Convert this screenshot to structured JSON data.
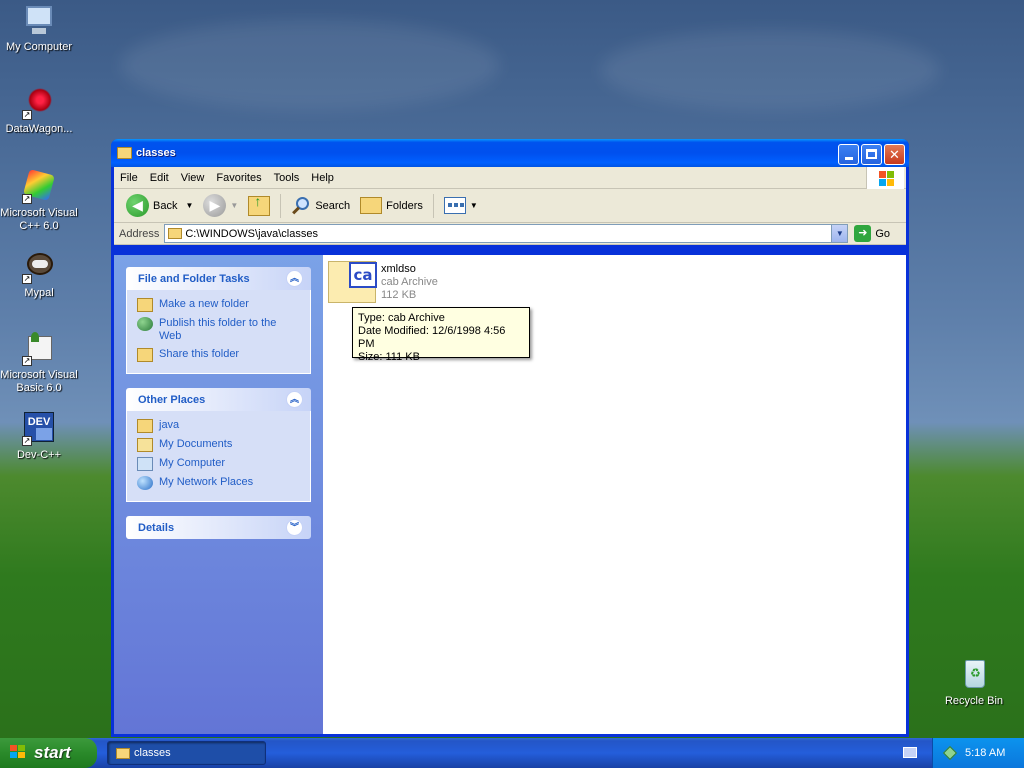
{
  "desktop": {
    "icons": [
      {
        "label": "My Computer"
      },
      {
        "label": "DataWagon..."
      },
      {
        "label": "Microsoft Visual C++ 6.0"
      },
      {
        "label": "Mypal"
      },
      {
        "label": "Microsoft Visual Basic 6.0"
      },
      {
        "label": "Dev-C++"
      },
      {
        "label": "Recycle Bin"
      }
    ]
  },
  "window": {
    "title": "classes",
    "menu": [
      "File",
      "Edit",
      "View",
      "Favorites",
      "Tools",
      "Help"
    ],
    "toolbar": {
      "back_label": "Back",
      "search_label": "Search",
      "folders_label": "Folders"
    },
    "address": {
      "label": "Address",
      "value": "C:\\WINDOWS\\java\\classes",
      "go_label": "Go"
    },
    "tasks": {
      "file_folder": {
        "title": "File and Folder Tasks",
        "items": [
          "Make a new folder",
          "Publish this folder to the Web",
          "Share this folder"
        ]
      },
      "other_places": {
        "title": "Other Places",
        "items": [
          "java",
          "My Documents",
          "My Computer",
          "My Network Places"
        ]
      },
      "details": {
        "title": "Details"
      }
    },
    "file": {
      "name": "xmldso",
      "type": "cab Archive",
      "size": "112 KB",
      "badge": "ca"
    },
    "tooltip": {
      "type": "Type: cab Archive",
      "modified": "Date Modified: 12/6/1998 4:56 PM",
      "size": "Size: 111 KB"
    }
  },
  "taskbar": {
    "start_label": "start",
    "task_label": "classes",
    "clock": "5:18 AM"
  },
  "colors": {
    "title_blue": "#0054e3",
    "taskpane_blue": "#6375d6",
    "link_blue": "#215dc6",
    "start_green": "#2a8a2a"
  }
}
